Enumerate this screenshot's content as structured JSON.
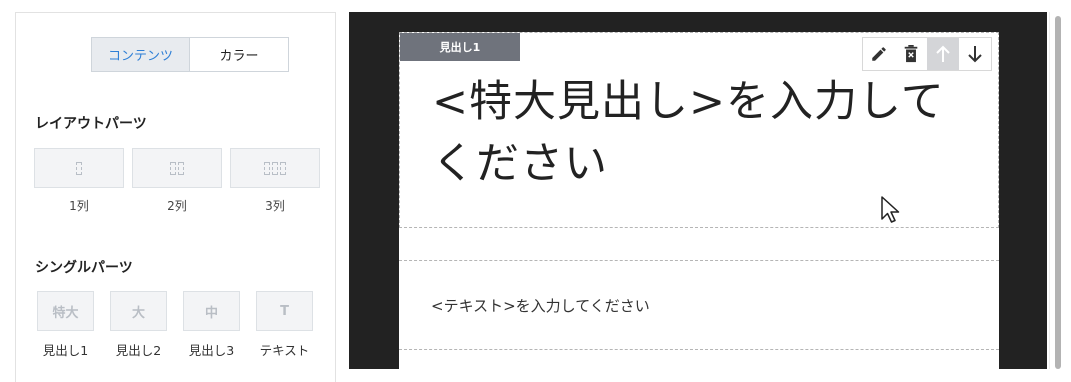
{
  "left_panel": {
    "tabs": [
      {
        "label": "コンテンツ",
        "active": true
      },
      {
        "label": "カラー",
        "active": false
      }
    ],
    "layout_section": {
      "title": "レイアウトパーツ",
      "items": [
        {
          "label": "1列",
          "columns": 1
        },
        {
          "label": "2列",
          "columns": 2
        },
        {
          "label": "3列",
          "columns": 3
        }
      ]
    },
    "single_section": {
      "title": "シングルパーツ",
      "items": [
        {
          "icon_text": "特大",
          "label": "見出し1"
        },
        {
          "icon_text": "大",
          "label": "見出し2"
        },
        {
          "icon_text": "中",
          "label": "見出し3"
        },
        {
          "icon_text": "T",
          "label": "テキスト"
        }
      ]
    }
  },
  "editor": {
    "heading_tag": "見出し1",
    "heading_text": "<特大見出し>を入力してください",
    "body_text": "<テキスト>を入力してください",
    "toolbar": [
      "edit-icon",
      "delete-icon",
      "move-up-icon",
      "move-down-icon"
    ]
  },
  "colors": {
    "accent_blue": "#2e7fd6",
    "editor_bg": "#222222",
    "tag_bg": "#6f737c"
  }
}
